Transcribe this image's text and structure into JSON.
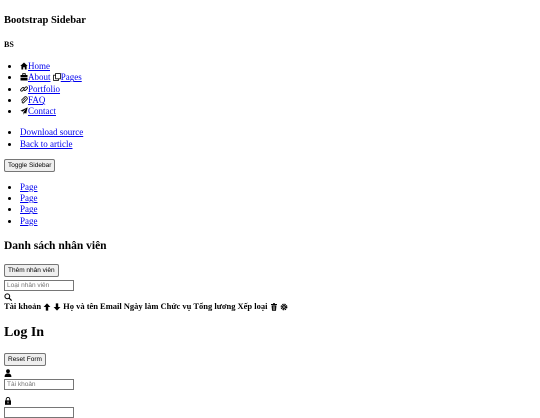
{
  "sidebar": {
    "title": "Bootstrap Sidebar",
    "brand": "BS",
    "nav": [
      {
        "label": "Home",
        "icon": "home-icon"
      },
      {
        "label": "About",
        "icon": "briefcase-icon"
      },
      {
        "label": "Pages",
        "icon": "copy-icon"
      },
      {
        "label": "Portfolio",
        "icon": "link-icon"
      },
      {
        "label": "FAQ",
        "icon": "paperclip-icon"
      },
      {
        "label": "Contact",
        "icon": "send-icon"
      }
    ],
    "links": [
      "Download source",
      "Back to article"
    ],
    "toggle_label": "Toggle Sidebar",
    "pages": [
      "Page",
      "Page",
      "Page",
      "Page"
    ]
  },
  "employees": {
    "heading": "Danh sách nhân viên",
    "add_button": "Thêm nhân viên",
    "search_placeholder": "Loại nhân viên",
    "columns": [
      "Tài khoản",
      "Họ và tên",
      "Email",
      "Ngày làm",
      "Chức vụ",
      "Tổng lương",
      "Xếp loại"
    ]
  },
  "login": {
    "heading": "Log In",
    "reset_button": "Reset Form",
    "username_placeholder": "Tài khoản"
  }
}
